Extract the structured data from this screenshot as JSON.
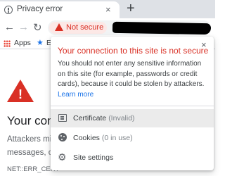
{
  "tab": {
    "title": "Privacy error",
    "close": "×",
    "new_tab": "+"
  },
  "toolbar": {
    "back": "←",
    "forward": "→",
    "reload": "↻",
    "security_chip": {
      "label": "Not secure",
      "icon": "warning-triangle-icon",
      "color": "#d93025"
    }
  },
  "bookmarks": {
    "apps": "Apps",
    "bookmark_initial": "E"
  },
  "page": {
    "heading": "Your conr",
    "text_line1": "Attackers mig",
    "text_line2": "messages, or",
    "error_code": "NET::ERR_CERT"
  },
  "popup": {
    "title": "Your connection to this site is not secure",
    "close": "×",
    "body": "You should not enter any sensitive information on this site (for example, passwords or credit cards), because it could be stolen by attackers.",
    "learn_more": "Learn more",
    "items": [
      {
        "label": "Certificate",
        "detail": "(Invalid)",
        "icon": "certificate-icon"
      },
      {
        "label": "Cookies",
        "detail": "(0 in use)",
        "icon": "cookie-icon"
      },
      {
        "label": "Site settings",
        "detail": "",
        "icon": "gear-icon"
      }
    ]
  },
  "colors": {
    "danger": "#d93025",
    "link": "#1a73e8",
    "hover_row": "#ebebeb"
  }
}
